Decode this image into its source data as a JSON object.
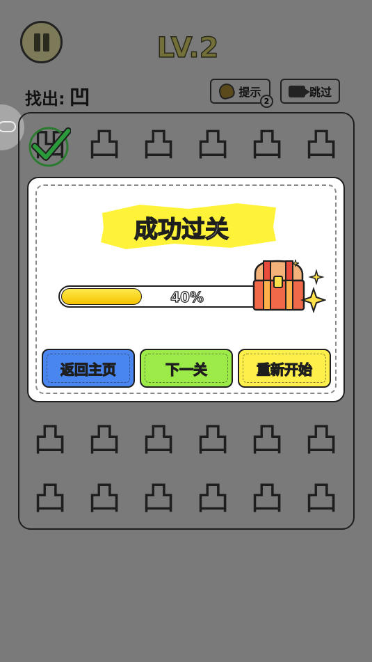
{
  "header": {
    "level": "LV.2",
    "find_label": "找出:",
    "target_glyph": "凹",
    "hint_label": "提示",
    "hint_count": "2",
    "skip_label": "跳过"
  },
  "board": {
    "glyph": "凸",
    "found_glyph": "凹"
  },
  "modal": {
    "title": "成功过关",
    "progress_text": "40%",
    "progress_value": 0.4,
    "buttons": {
      "home": "返回主页",
      "next": "下一关",
      "restart": "重新开始"
    }
  },
  "colors": {
    "overlay": "#7a7a7a",
    "banner": "#fff33a",
    "progress": "#f5c400",
    "home_button": "#4a86f0",
    "next_button": "#9ceb48",
    "restart_button": "#ffef4a",
    "check": "#2a9a3a"
  },
  "icons": {
    "pause": "pause-icon",
    "hint": "bell-icon",
    "skip": "video-camera-icon",
    "side": "gamepad-icon",
    "chest": "treasure-chest-icon",
    "found": "checkmark-icon"
  }
}
